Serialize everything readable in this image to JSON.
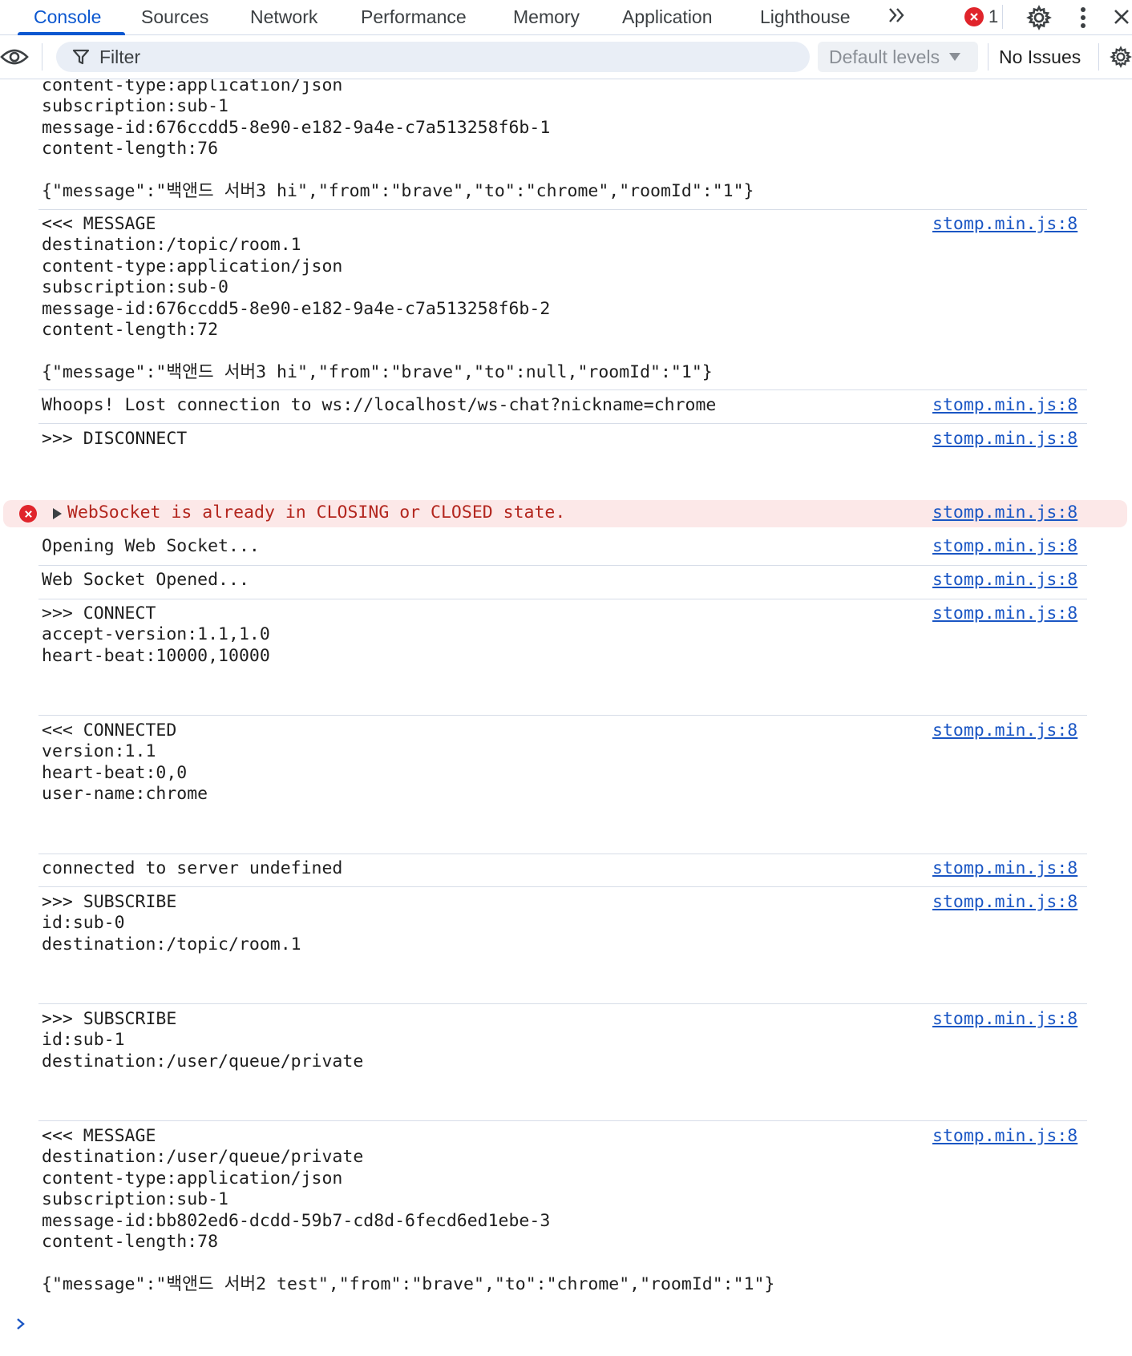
{
  "tabs": [
    {
      "label": "Console",
      "active": true
    },
    {
      "label": "Sources"
    },
    {
      "label": "Network"
    },
    {
      "label": "Performance"
    },
    {
      "label": "Memory"
    },
    {
      "label": "Application"
    },
    {
      "label": "Lighthouse"
    }
  ],
  "toolbar": {
    "error_count": "1",
    "filter_label": "Filter",
    "levels_label": "Default levels",
    "issues_label": "No Issues"
  },
  "colors": {
    "accent": "#0b57d0",
    "error": "#e0242b",
    "error_bg": "#fce8e8",
    "link": "#1a56c4"
  },
  "console": {
    "entries": [
      {
        "text": "content-type:application/json\nsubscription:sub-1\nmessage-id:676ccdd5-8e90-e182-9a4e-c7a513258f6b-1\ncontent-length:76\n\n{\"message\":\"백앤드 서버3 hi\",\"from\":\"brave\",\"to\":\"chrome\",\"roomId\":\"1\"}",
        "source": ""
      },
      {
        "text": "<<< MESSAGE\ndestination:/topic/room.1\ncontent-type:application/json\nsubscription:sub-0\nmessage-id:676ccdd5-8e90-e182-9a4e-c7a513258f6b-2\ncontent-length:72\n\n{\"message\":\"백앤드 서버3 hi\",\"from\":\"brave\",\"to\":null,\"roomId\":\"1\"}",
        "source": "stomp.min.js:8"
      },
      {
        "text": "Whoops! Lost connection to ws://localhost/ws-chat?nickname=chrome",
        "source": "stomp.min.js:8"
      },
      {
        "text": ">>> DISCONNECT",
        "source": "stomp.min.js:8"
      },
      {
        "text": "WebSocket is already in CLOSING or CLOSED state.",
        "source": "stomp.min.js:8",
        "level": "error"
      },
      {
        "text": "Opening Web Socket...",
        "source": "stomp.min.js:8"
      },
      {
        "text": "Web Socket Opened...",
        "source": "stomp.min.js:8"
      },
      {
        "text": ">>> CONNECT\naccept-version:1.1,1.0\nheart-beat:10000,10000",
        "source": "stomp.min.js:8"
      },
      {
        "text": "<<< CONNECTED\nversion:1.1\nheart-beat:0,0\nuser-name:chrome",
        "source": "stomp.min.js:8"
      },
      {
        "text": "connected to server undefined",
        "source": "stomp.min.js:8"
      },
      {
        "text": ">>> SUBSCRIBE\nid:sub-0\ndestination:/topic/room.1",
        "source": "stomp.min.js:8"
      },
      {
        "text": ">>> SUBSCRIBE\nid:sub-1\ndestination:/user/queue/private",
        "source": "stomp.min.js:8"
      },
      {
        "text": "<<< MESSAGE\ndestination:/user/queue/private\ncontent-type:application/json\nsubscription:sub-1\nmessage-id:bb802ed6-dcdd-59b7-cd8d-6fecd6ed1ebe-3\ncontent-length:78\n\n{\"message\":\"백앤드 서버2 test\",\"from\":\"brave\",\"to\":\"chrome\",\"roomId\":\"1\"}",
        "source": "stomp.min.js:8"
      }
    ]
  }
}
